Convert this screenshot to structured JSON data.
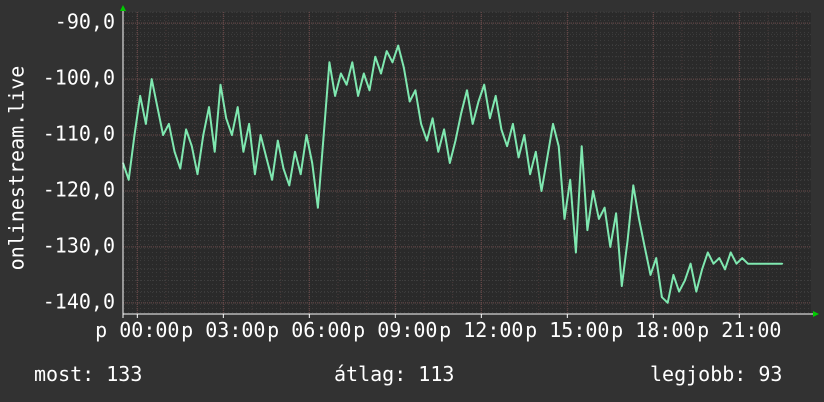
{
  "chart_data": {
    "type": "line",
    "ylabel": "onlinestream.live",
    "y_ticks": [
      -90,
      -100,
      -110,
      -120,
      -130,
      -140
    ],
    "y_tick_labels": [
      "-90,0",
      "-100,0",
      "-110,0",
      "-120,0",
      "-130,0",
      "-140,0"
    ],
    "ylim": [
      -142,
      -88
    ],
    "x_tick_labels": [
      "p 00:00",
      "p 03:00",
      "p 06:00",
      "p 09:00",
      "p 12:00",
      "p 15:00",
      "p 18:00",
      "p 21:00"
    ],
    "x_tick_hours": [
      0,
      3,
      6,
      9,
      12,
      15,
      18,
      21
    ],
    "xlim_hours": [
      -0.5,
      23.5
    ],
    "grid": true,
    "series": [
      {
        "color": "#7fe8b0",
        "x_hours": [
          -0.5,
          -0.3,
          -0.1,
          0.1,
          0.3,
          0.5,
          0.7,
          0.9,
          1.1,
          1.3,
          1.5,
          1.7,
          1.9,
          2.1,
          2.3,
          2.5,
          2.7,
          2.9,
          3.1,
          3.3,
          3.5,
          3.7,
          3.9,
          4.1,
          4.3,
          4.5,
          4.7,
          4.9,
          5.1,
          5.3,
          5.5,
          5.7,
          5.9,
          6.1,
          6.3,
          6.5,
          6.7,
          6.9,
          7.1,
          7.3,
          7.5,
          7.7,
          7.9,
          8.1,
          8.3,
          8.5,
          8.7,
          8.9,
          9.1,
          9.3,
          9.5,
          9.7,
          9.9,
          10.1,
          10.3,
          10.5,
          10.7,
          10.9,
          11.1,
          11.3,
          11.5,
          11.7,
          11.9,
          12.1,
          12.3,
          12.5,
          12.7,
          12.9,
          13.1,
          13.3,
          13.5,
          13.7,
          13.9,
          14.1,
          14.3,
          14.5,
          14.7,
          14.9,
          15.1,
          15.3,
          15.5,
          15.7,
          15.9,
          16.1,
          16.3,
          16.5,
          16.7,
          16.9,
          17.1,
          17.3,
          17.5,
          17.7,
          17.9,
          18.1,
          18.3,
          18.5,
          18.7,
          18.9,
          19.1,
          19.3,
          19.5,
          19.7,
          19.9,
          20.1,
          20.3,
          20.5,
          20.7,
          20.9,
          21.1,
          21.3,
          21.5,
          21.7,
          21.9,
          22.1,
          22.3,
          22.5
        ],
        "values": [
          -115,
          -118,
          -110,
          -103,
          -108,
          -100,
          -105,
          -110,
          -108,
          -113,
          -116,
          -109,
          -112,
          -117,
          -110,
          -105,
          -113,
          -101,
          -107,
          -110,
          -105,
          -113,
          -108,
          -117,
          -110,
          -114,
          -118,
          -111,
          -116,
          -119,
          -113,
          -117,
          -110,
          -115,
          -123,
          -110,
          -97,
          -103,
          -99,
          -101,
          -97,
          -103,
          -99,
          -102,
          -96,
          -99,
          -95,
          -97,
          -94,
          -98,
          -104,
          -102,
          -108,
          -111,
          -107,
          -113,
          -109,
          -115,
          -111,
          -106,
          -102,
          -108,
          -104,
          -101,
          -107,
          -103,
          -109,
          -112,
          -108,
          -114,
          -110,
          -117,
          -113,
          -120,
          -114,
          -108,
          -112,
          -125,
          -118,
          -131,
          -112,
          -127,
          -120,
          -125,
          -123,
          -130,
          -124,
          -137,
          -129,
          -119,
          -125,
          -130,
          -135,
          -132,
          -139,
          -140,
          -135,
          -138,
          -136,
          -133,
          -138,
          -134,
          -131,
          -133,
          -132,
          -134,
          -131,
          -133,
          -132,
          -133,
          -133,
          -133,
          -133,
          -133,
          -133,
          -133
        ]
      }
    ]
  },
  "stats": {
    "current": "most: 133",
    "average": "átlag: 113",
    "best": "legjobb: 93"
  }
}
